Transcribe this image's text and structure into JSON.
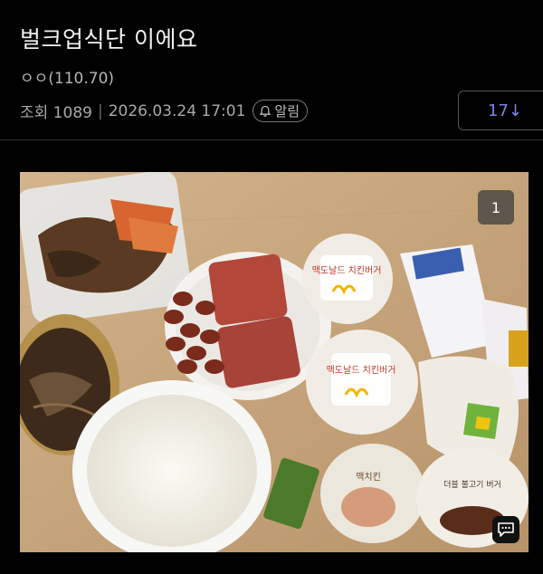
{
  "post": {
    "title": "벌크업식단 이에요",
    "author": "ㅇㅇ(110.70)",
    "views_label": "조회 1089",
    "datetime": "2026.03.24 17:01",
    "alarm_label": "알림",
    "comment_count": "17↓"
  },
  "image": {
    "counter": "1",
    "wrapper_text_1": "맥도날드 치킨버거",
    "wrapper_text_2": "맥도날드 치킨버거",
    "wrapper_text_3": "맥치킨",
    "wrapper_text_4": "더블 불고기 버거"
  },
  "colors": {
    "background": "#000000",
    "accent": "#7d86e8",
    "text_secondary": "#a9a9a9"
  }
}
